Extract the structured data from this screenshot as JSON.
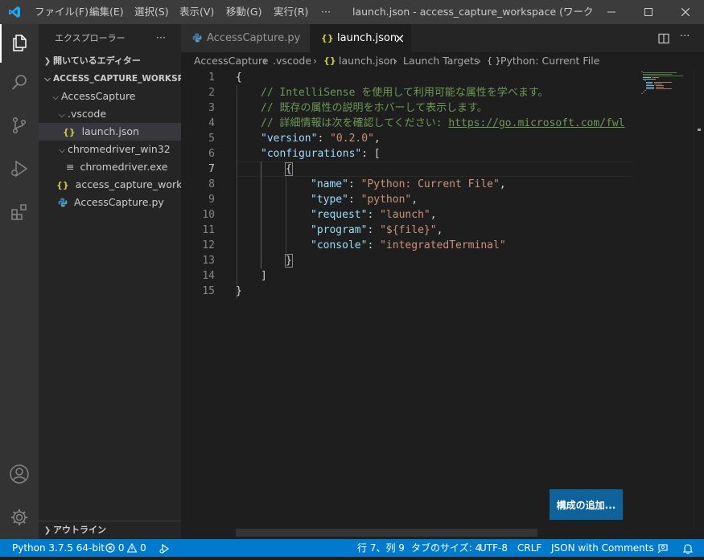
{
  "titlebar": {
    "menus": [
      "ファイル(F)",
      "編集(E)",
      "選択(S)",
      "表示(V)",
      "移動(G)",
      "実行(R)",
      "···"
    ],
    "window_title": "launch.json - access_capture_workspace (ワークスペース) ..."
  },
  "sidebar": {
    "title": "エクスプローラー",
    "more": "···",
    "open_editors": "開いているエディター",
    "workspace": "ACCESS_CAPTURE_WORKSP...",
    "tree": [
      {
        "label": "AccessCapture"
      },
      {
        "label": ".vscode"
      },
      {
        "label": "launch.json",
        "icon": "{}"
      },
      {
        "label": "chromedriver_win32"
      },
      {
        "label": "chromedriver.exe"
      },
      {
        "label": "access_capture_works...",
        "icon": "{}"
      },
      {
        "label": "AccessCapture.py"
      }
    ],
    "outline": "アウトライン"
  },
  "tabs": [
    {
      "label": "AccessCapture.py"
    },
    {
      "label": "launch.json",
      "icon": "{}",
      "close": "×"
    }
  ],
  "breadcrumb": [
    "AccessCapture",
    ".vscode",
    "launch.json",
    "Launch Targets",
    "Python: Current File"
  ],
  "editor": {
    "line_numbers": [
      "1",
      "2",
      "3",
      "4",
      "5",
      "6",
      "7",
      "8",
      "9",
      "10",
      "11",
      "12",
      "13",
      "14",
      "15"
    ],
    "comments": [
      "// IntelliSense を使用して利用可能な属性を学べます。",
      "// 既存の属性の説明をホバーして表示します。",
      "// 詳細情報は次を確認してください: "
    ],
    "link": "https://go.microsoft.com/fwl",
    "version_key": "\"version\"",
    "version_val": "\"0.2.0\"",
    "configurations_key": "\"configurations\"",
    "config": [
      {
        "key": "\"name\"",
        "value": "\"Python: Current File\""
      },
      {
        "key": "\"type\"",
        "value": "\"python\""
      },
      {
        "key": "\"request\"",
        "value": "\"launch\""
      },
      {
        "key": "\"program\"",
        "value": "\"${file}\""
      },
      {
        "key": "\"console\"",
        "value": "\"integratedTerminal\""
      }
    ]
  },
  "add_config_button": "構成の追加...",
  "statusbar": {
    "python": "Python 3.7.5 64-bit",
    "errors": "0",
    "warnings": "0",
    "cursor": "行 7、列 9",
    "tab_size": "タブのサイズ: 4",
    "encoding": "UTF-8",
    "eol": "CRLF",
    "language": "JSON with Comments"
  },
  "colors": {
    "accent": "#007acc",
    "button": "#0e639c",
    "comment": "#6a9955",
    "key": "#9cdcfe",
    "string": "#ce9178"
  }
}
